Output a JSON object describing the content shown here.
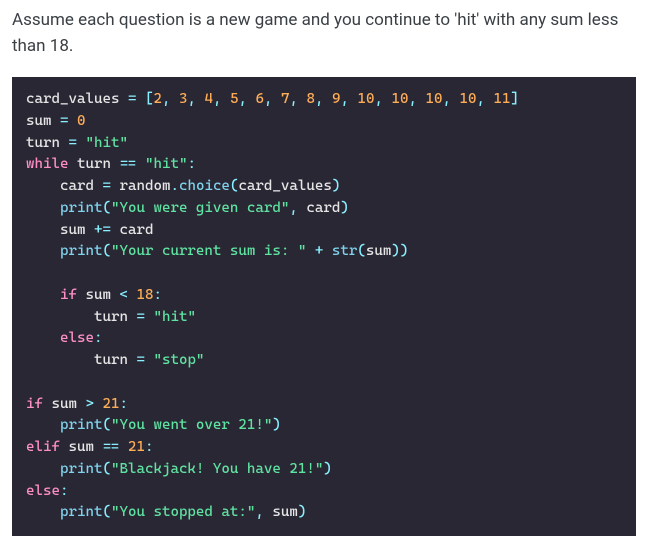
{
  "instruction": "Assume each question is a new game and you continue to 'hit' with any sum less than 18.",
  "code": {
    "line1": {
      "var": "card_values",
      "eq": "=",
      "lbracket": "[",
      "nums": [
        "2",
        "3",
        "4",
        "5",
        "6",
        "7",
        "8",
        "9",
        "10",
        "10",
        "10",
        "10",
        "11"
      ],
      "commas": ", ",
      "rbracket": "]"
    },
    "line2": {
      "var": "sum",
      "eq": "=",
      "num": "0"
    },
    "line3": {
      "var": "turn",
      "eq": "=",
      "str": "\"hit\""
    },
    "line4": {
      "kw": "while",
      "var": "turn",
      "op": "==",
      "str": "\"hit\"",
      "colon": ":"
    },
    "line5": {
      "var": "card",
      "eq": "=",
      "obj": "random",
      "dot": ".",
      "func": "choice",
      "lp": "(",
      "arg": "card_values",
      "rp": ")"
    },
    "line6": {
      "func": "print",
      "lp": "(",
      "str": "\"You were given card\"",
      "comma": ",",
      "arg": "card",
      "rp": ")"
    },
    "line7": {
      "var": "sum",
      "op": "+=",
      "arg": "card"
    },
    "line8": {
      "func": "print",
      "lp": "(",
      "str": "\"Your current sum is: \"",
      "plus": "+",
      "func2": "str",
      "lp2": "(",
      "arg": "sum",
      "rp2": ")",
      "rp": ")"
    },
    "line9_blank": "",
    "line10": {
      "kw": "if",
      "var": "sum",
      "op": "<",
      "num": "18",
      "colon": ":"
    },
    "line11": {
      "var": "turn",
      "eq": "=",
      "str": "\"hit\""
    },
    "line12": {
      "kw": "else",
      "colon": ":"
    },
    "line13": {
      "var": "turn",
      "eq": "=",
      "str": "\"stop\""
    },
    "line14_blank": "",
    "line15": {
      "kw": "if",
      "var": "sum",
      "op": ">",
      "num": "21",
      "colon": ":"
    },
    "line16": {
      "func": "print",
      "lp": "(",
      "str": "\"You went over 21!\"",
      "rp": ")"
    },
    "line17": {
      "kw": "elif",
      "var": "sum",
      "op": "==",
      "num": "21",
      "colon": ":"
    },
    "line18": {
      "func": "print",
      "lp": "(",
      "str": "\"Blackjack! You have 21!\"",
      "rp": ")"
    },
    "line19": {
      "kw": "else",
      "colon": ":"
    },
    "line20": {
      "func": "print",
      "lp": "(",
      "str": "\"You stopped at:\"",
      "comma": ",",
      "arg": "sum",
      "rp": ")"
    }
  }
}
